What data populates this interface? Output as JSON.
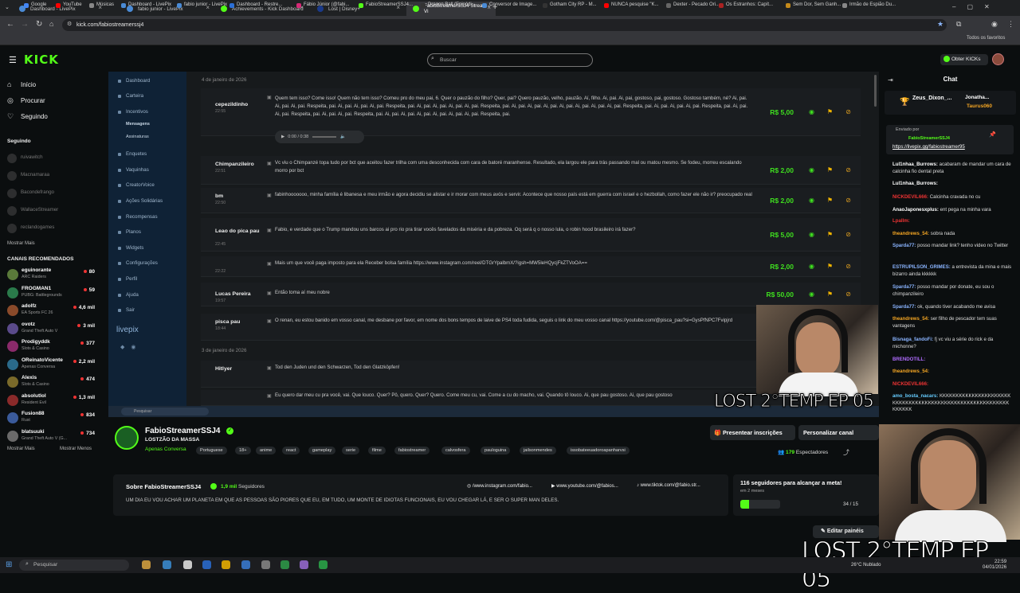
{
  "browser": {
    "tabs": [
      {
        "label": "Dashboard - LivePix",
        "color": "#4a8bd6"
      },
      {
        "label": "fabio junior - LivePix",
        "color": "#4a8bd6"
      },
      {
        "label": "Achievements - Kick Dashboard",
        "color": "#53fc18"
      },
      {
        "label": "Lost | Disney+",
        "color": "#1a3a8a"
      },
      {
        "label": "FabioStreamerSSJ4 Stream - Vi",
        "color": "#53fc18"
      }
    ],
    "url": "kick.com/fabiostreamerssj4",
    "bookmarks": [
      {
        "label": "Google",
        "color": "#4285f4"
      },
      {
        "label": "YouTube",
        "color": "#ff0000"
      },
      {
        "label": "Músicas",
        "color": "#888"
      },
      {
        "label": "Dashboard - LivePix",
        "color": "#4a8bd6"
      },
      {
        "label": "fabio junior - LivePix",
        "color": "#4a8bd6"
      },
      {
        "label": "Dashboard - Restre...",
        "color": "#2b6fd6"
      },
      {
        "label": "Fábio Júnior (@fabi...",
        "color": "#d62976"
      },
      {
        "label": "FabioStreamerSSJ4...",
        "color": "#53fc18"
      },
      {
        "label": "Dragon Ball (Episódi...",
        "color": "#333"
      },
      {
        "label": "Conversor de Image...",
        "color": "#4a8bd6"
      },
      {
        "label": "Gotham City RP - M...",
        "color": "#333"
      },
      {
        "label": "NUNCA pesquise \"K...",
        "color": "#ff0000"
      },
      {
        "label": "Dexter - Pecado Ori...",
        "color": "#666"
      },
      {
        "label": "Os Estranhos: Capít...",
        "color": "#aa2222"
      },
      {
        "label": "Sem Dor, Sem Ganh...",
        "color": "#c58a1a"
      },
      {
        "label": "Irmão de Espião Du...",
        "color": "#888"
      }
    ],
    "all_favorites": "Todos os favoritos"
  },
  "kick": {
    "logo": "KICK",
    "search_placeholder": "Buscar",
    "get_kicks": "Obter KICKs",
    "nav": [
      "Início",
      "Procurar",
      "Seguindo"
    ],
    "following_title": "Seguindo",
    "following": [
      "ruivawitch",
      "Macnamaraa",
      "Bacondefrango",
      "WallaceStreamer",
      "reclandogames"
    ],
    "show_more": "Mostrar Mais",
    "recommended_title": "CANAIS RECOMENDADOS",
    "recommended": [
      {
        "name": "eguinorante",
        "game": "ARC Raiders",
        "count": "80",
        "color": "#5a7a3a"
      },
      {
        "name": "FROGMAN1",
        "game": "PUBG: Battlegrounds",
        "count": "59",
        "color": "#2a7a4a"
      },
      {
        "name": "adolfz",
        "game": "EA Sports FC 26",
        "count": "4,6 mil",
        "color": "#8a4a2a"
      },
      {
        "name": "ovotz",
        "game": "Grand Theft Auto V",
        "count": "3 mil",
        "color": "#5a4a8a"
      },
      {
        "name": "Prodigyddk",
        "game": "Slots & Casino",
        "count": "377",
        "color": "#8a2a6a"
      },
      {
        "name": "OReinatoVicente",
        "game": "Apenas Conversa",
        "count": "2,2 mil",
        "color": "#2a6a8a"
      },
      {
        "name": "Alexis",
        "game": "Slots & Casino",
        "count": "474",
        "color": "#7a6a2a"
      },
      {
        "name": "absolutlol",
        "game": "Resident Evil",
        "count": "1,3 mil",
        "color": "#8a2a2a"
      },
      {
        "name": "Fusion88",
        "game": "Rust",
        "count": "834",
        "color": "#3a5a9a"
      },
      {
        "name": "blatsuuki",
        "game": "Grand Theft Auto V (G...",
        "count": "734",
        "color": "#6a6a6a"
      }
    ],
    "show_less": "Mostrar Menos"
  },
  "livepix": {
    "menu": [
      "Dashboard",
      "Carteira",
      "Incentivos",
      "Mensagens",
      "Assinaturas",
      "Enquetes",
      "Vaquinhas",
      "CreatorVoice",
      "Ações Solidárias",
      "Recompensas",
      "Planos",
      "Widgets",
      "Configurações",
      "Perfil",
      "Ajuda",
      "Sair"
    ],
    "brand": "livepix",
    "date1": "4 de janeiro de 2026",
    "date2": "3 de janeiro de 2026",
    "audio_time": "0:00 / 0:38",
    "search_placeholder": "Pesquisar",
    "rows": [
      {
        "name": "cepezildinho",
        "time": "22:55",
        "msg": "Quem tem isso? Come isso! Quem não tem isso? Comeu pro do meu pai, 6. Quer o pauzão do filho? Quer, pai? Quero pauzão, velho, pauzão. Aí, filho. Ai, pai. Ai, pai, gostoso, pai, gostoso. Gostoso também, né? Ai, pai. Ai, pai. Ai, pai. Respeita, pai. Ai, pai. Ai, pai. Ai, pai. Respeita, pai. Ai, pai. Ai, pai. Ai, pai. Ai, pai. Respeita, pai. Ai, pai. Ai, pai. Ai, pai. Ai, pai. Ai, pai. Ai, pai. Ai, pai. Respeita, pai. Ai, pai. Ai, pai. Ai, pai. Respeita, pai. Ai, pai. Ai, pai. Respeita, pai. Ai, pai. Ai, pai. Respeita, pai. Ai, pai. Ai, pai. Ai, pai. Ai, pai. Ai, pai. Ai, pai. Respeita, pai.",
        "amount": "R$ 5,00"
      },
      {
        "name": "Chimpanzileiro",
        "time": "22:51",
        "msg": "Vc viu o Chimpanzé topa tudo por bct que aceitou fazer trilha com uma desconhecida com cara de batoré maranhense. Resultado, ela largou ele para trás passando mal ou matou mesmo. Se fodeu, morreu escalando morro por bct",
        "amount": "R$ 2,00"
      },
      {
        "name": "bm",
        "time": "22:50",
        "msg": "fabinhooooooo, minha família é libanesa e meu irmão e agora decidiu se alistar e ir morar com meus avós e servir. Acontece que nosso país está em guerra com israel e o hezbollah, como fazer ele não ir? preocupado real",
        "amount": "R$ 2,00"
      },
      {
        "name": "Leao do pica pau",
        "time": "22:45",
        "msg": "Fabio, e verdade que o Trump mandou uns barcos ai pro rio pra tirar vocês favelados da miséria e da pobreza. Oq será q o nosso lula, o robin hood brasileiro irá fazer?",
        "amount": "R$ 5,00"
      },
      {
        "name": "",
        "time": "22:22",
        "msg": "Mais um que você paga imposto para ela Receber bolsa família https://www.instagram.com/reel/DTGrYpalbmX/?igsh=MW5leHQycjFkZTVoOA==",
        "amount": "R$ 2,00"
      },
      {
        "name": "Lucas Pereira",
        "time": "19:57",
        "msg": "Então toma aí meu nobre",
        "amount": "R$ 50,00"
      },
      {
        "name": "pisca pau",
        "time": "18:44",
        "msg": "O renan, eu estou banido em vosso canal, me desbane por favor, em nome dos bons tempos de laive de PS4 toda fudida, seguis o link do meu vosso canal https://youtube.com/@pisca_pau?si=GysPfNPC7Fvipjrd",
        "amount": ""
      },
      {
        "name": "Hitlyer",
        "time": "",
        "msg": "Tod den Juden und den Schwarzen, Tod den Glatzköpfen!",
        "amount": ""
      },
      {
        "name": "",
        "time": "",
        "msg": "Eu quero dar meu cu pra você, vai. Que louco. Quer? Pô, quero. Quer? Quero. Come meu cu, vai. Come a cu do macho, vai. Quando tô louco. Ai, que pau gostoso. Ai, que pau gostoso",
        "amount": ""
      }
    ]
  },
  "overlay_text": "LOST 2°TEMP EP 05",
  "channel": {
    "name": "FabioStreamerSSJ4",
    "title": "LOSTZÃO DA MASSA",
    "category": "Apenas Conversa",
    "tags": [
      "Portuguese",
      "18+",
      "anime",
      "react",
      "gameplay",
      "serie",
      "filme",
      "fabiostreamer",
      "calvosfera",
      "pauloguina",
      "jailsonmendes",
      "issobateeuadoroapanharvsi"
    ],
    "btn_subs": "Presentear inscrições",
    "btn_personalize": "Personalizar canal",
    "viewers_count": "179",
    "viewers_label": "Espectadores",
    "about_title": "Sobre FabioStreamerSSJ4",
    "followers_count": "1,9 mil",
    "followers_label": "Seguidores",
    "about_text": "UM DIA EU VOU ACHAR UM PLANETA EM QUE AS PESSOAS SÃO PIORES QUE EU, EM TUDO, UM MONTE DE IDIOTAS FUNCIONAIS, EU VOU CHEGAR LÁ, E SER O SUPER MAN DELES.",
    "social": [
      "/www.instagram.com/fabio...",
      "www.youtube.com/@fabios...",
      "www.tiktok.com/@fabio.str..."
    ],
    "goal_title": "116 seguidores para alcançar a meta!",
    "goal_sub": "em 2 meses",
    "goal_progress": "34 / 15",
    "goal_fraction": 0.22,
    "edit_btn": "Editar painéis"
  },
  "chat": {
    "title": "Chat",
    "top": [
      "Zeus_Dixon_...",
      "Jonatha...",
      "Taurus060"
    ],
    "pinned_label": "Enviado por",
    "pinned_user": "FabioStreamerSSJ4",
    "pinned_link": "https://livepix.gg/fabiostreamer95",
    "messages": [
      {
        "user": "Lul1nhaa_Burrows:",
        "color": "#fff",
        "text": "acabaram de mandar um cara de calcinha fio dental preta"
      },
      {
        "user": "Lul1nhaa_Burrows:",
        "color": "#fff",
        "text": ""
      },
      {
        "user": "NICKDEVIL666:",
        "color": "#e33",
        "text": "Calcinha cravada no cu"
      },
      {
        "user": "AnaoJaponesxplus:",
        "color": "#fff",
        "text": "ent pega na minha vara"
      },
      {
        "user": "Lpallm:",
        "color": "#e33",
        "text": ""
      },
      {
        "user": "theandrews_54:",
        "color": "#f5a623",
        "text": "sobra nada"
      },
      {
        "user": "Sparda77:",
        "color": "#8ab4ff",
        "text": "posso mandar link? tenho video no Twitter"
      },
      {
        "user": "ESTRUPILSON_GRIMES:",
        "color": "#8ab4ff",
        "text": "a entrevista da mina e mais bizarro ainda kkkkkk"
      },
      {
        "user": "Sparda77:",
        "color": "#8ab4ff",
        "text": "posso mandar por donate, eu sou o chimpanzileiro"
      },
      {
        "user": "Sparda77:",
        "color": "#8ab4ff",
        "text": "ok, quando tiver acabando me avisa"
      },
      {
        "user": "theandrews_54:",
        "color": "#f5a623",
        "text": "ser filho de pescador tem suas vantagens"
      },
      {
        "user": "Bisnaga_fandoFi:",
        "color": "#8ab4ff",
        "text": "fj vc viu a série do rick e da michonne?"
      },
      {
        "user": "BRENDOTILL:",
        "color": "#b06cff",
        "text": ""
      },
      {
        "user": "theandrews_54:",
        "color": "#f5a623",
        "text": ""
      },
      {
        "user": "NICKDEVIL666:",
        "color": "#e33",
        "text": ""
      },
      {
        "user": "amo_bosta_nacars:",
        "color": "#6cf",
        "text": "KKKKKKKKKKKKKKKKKKKKKKKKKKKKKKKKKKKKKKKKKKKKKKKKKKKKKKKKKKKKKKKK"
      }
    ]
  },
  "taskbar": {
    "search": "Pesquisar",
    "weather": "26°C Nublado",
    "time": "22:59",
    "date": "04/01/2026"
  }
}
